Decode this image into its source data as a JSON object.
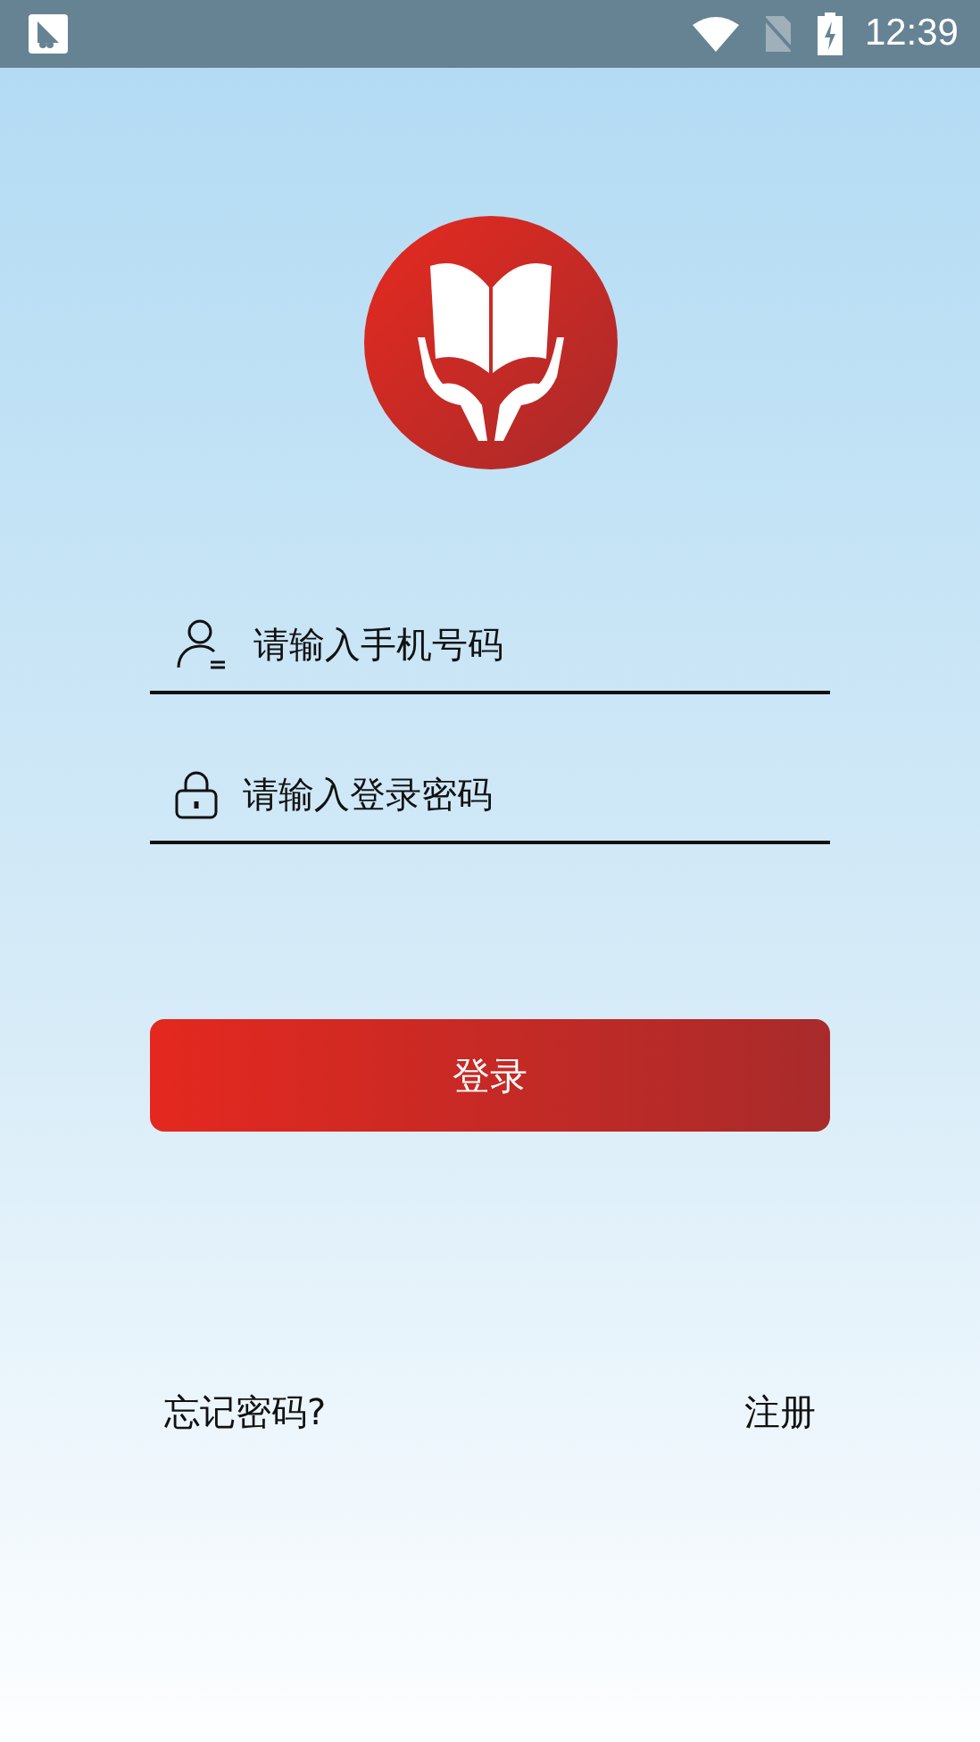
{
  "status_bar": {
    "time": "12:39"
  },
  "fields": [
    {
      "kind": "phone",
      "placeholder": "请输入手机号码"
    },
    {
      "kind": "password",
      "placeholder": "请输入登录密码"
    }
  ],
  "login_button": "登录",
  "links": {
    "forgot": "忘记密码?",
    "register": "注册"
  }
}
